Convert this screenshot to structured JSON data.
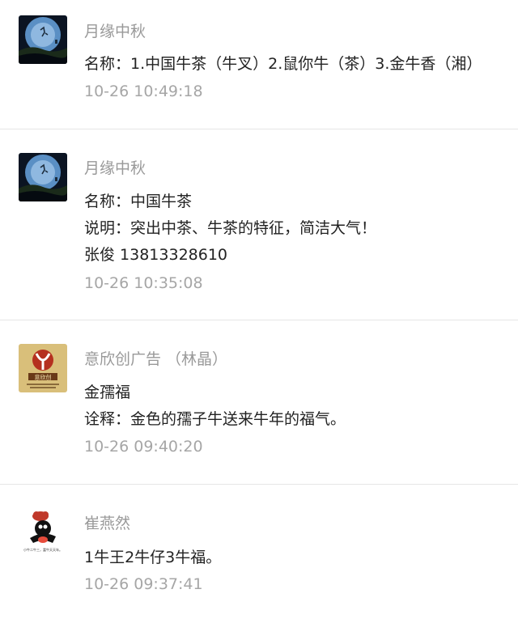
{
  "comments": [
    {
      "author": "月缘中秋",
      "avatar_icon": "moon-night-avatar-icon",
      "lines": [
        "名称：1.中国牛茶（牛叉）2.鼠你牛（茶）3.金牛香（湘）"
      ],
      "time": "10-26 10:49:18"
    },
    {
      "author": "月缘中秋",
      "avatar_icon": "moon-night-avatar-icon",
      "lines": [
        "名称：中国牛茶",
        "说明：突出中茶、牛茶的特征，简洁大气！",
        "张俊  13813328610"
      ],
      "time": "10-26 10:35:08"
    },
    {
      "author": "意欣创广告 （林晶）",
      "avatar_icon": "agency-logo-avatar-icon",
      "avatar_logo_text": "意欣创",
      "lines": [
        "金孺福",
        "诠释：金色的孺子牛送来牛年的福气。"
      ],
      "time": "10-26 09:40:20"
    },
    {
      "author": "崔燕然",
      "avatar_icon": "cartoon-avatar-icon",
      "avatar_caption": "小牛二牛三，富牛天天年。",
      "lines": [
        "1牛王2牛仔3牛福。"
      ],
      "time": "10-26 09:37:41"
    }
  ]
}
